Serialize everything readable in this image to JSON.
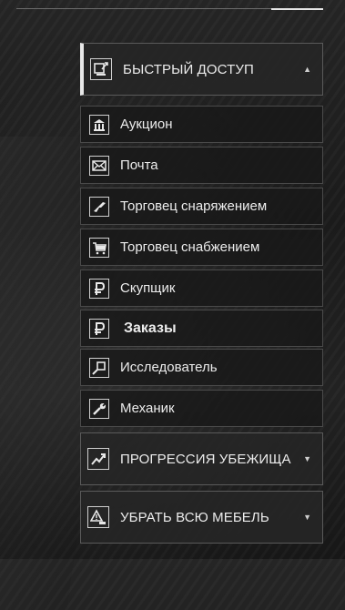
{
  "quick_access": {
    "title": "БЫСТРЫЙ ДОСТУП",
    "arrow": "▲",
    "icon": "quick-access-icon"
  },
  "items": [
    {
      "label": "Аукцион",
      "icon": "auction-icon"
    },
    {
      "label": "Почта",
      "icon": "mail-icon"
    },
    {
      "label": "Торговец снаряжением",
      "icon": "gun-icon"
    },
    {
      "label": "Торговец снабжением",
      "icon": "cart-icon"
    },
    {
      "label": "Скупщик",
      "icon": "ruble-icon"
    },
    {
      "label": "Заказы",
      "icon": "ruble-icon"
    },
    {
      "label": "Исследователь",
      "icon": "magnifier-icon"
    },
    {
      "label": "Механик",
      "icon": "wrench-icon"
    }
  ],
  "shelter_progression": {
    "title": "ПРОГРЕССИЯ УБЕЖИЩА",
    "arrow": "▼",
    "icon": "progress-chart-icon"
  },
  "remove_furniture": {
    "title": "УБРАТЬ ВСЮ МЕБЕЛЬ",
    "arrow": "▼",
    "icon": "warning-icon"
  }
}
